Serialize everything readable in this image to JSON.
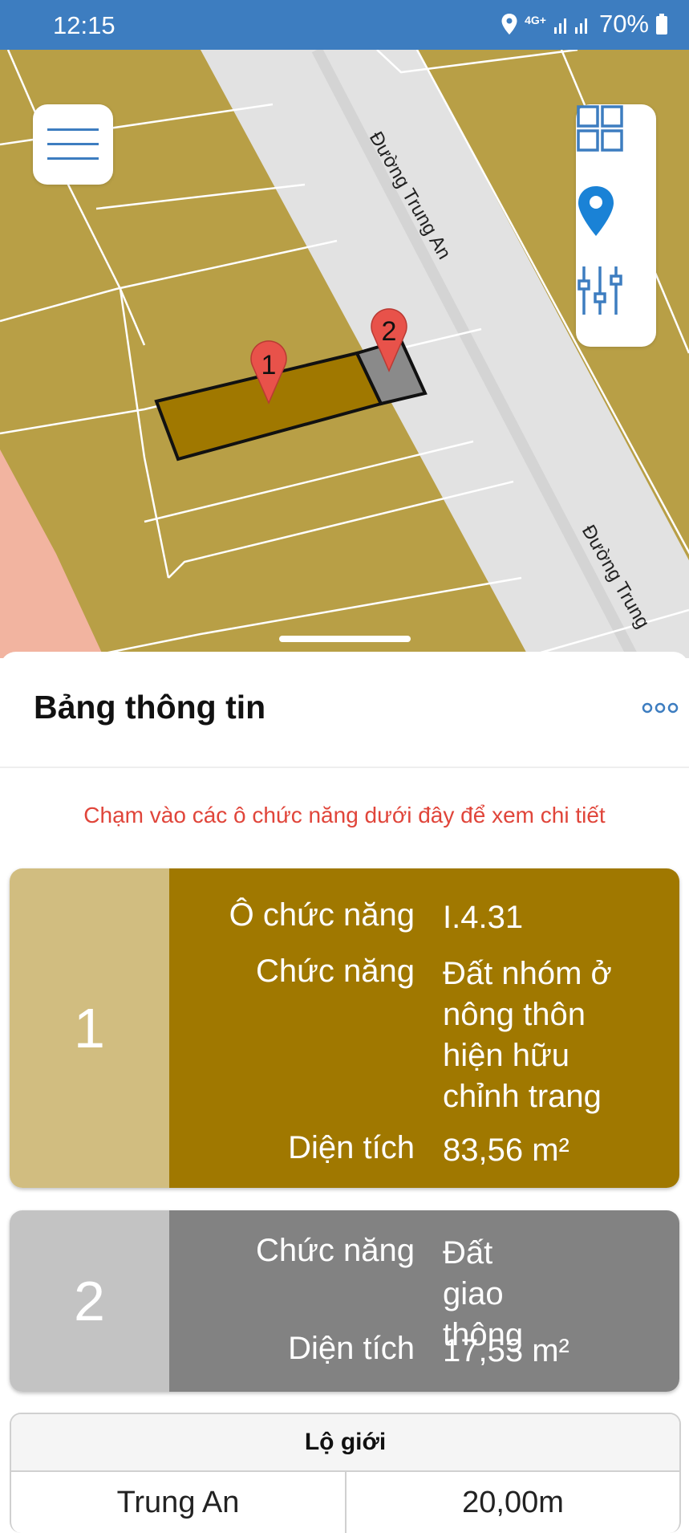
{
  "status_bar": {
    "time": "12:15",
    "network": "4G+",
    "battery": "70%"
  },
  "map": {
    "road_label_1": "Đường Trung An",
    "road_label_2": "Đường Trung",
    "markers": [
      "1",
      "2"
    ],
    "colors": {
      "land": "#b89f46",
      "road": "#e2e2e2",
      "highlight_parcel": "#a07800",
      "road_parcel": "#8a8a8a",
      "pink_zone": "#f2b4a0"
    }
  },
  "controls": {
    "menu_icon": "hamburger-menu-icon",
    "grid_icon": "grid-icon",
    "location_icon": "location-pin-icon",
    "filter_icon": "sliders-icon"
  },
  "sheet": {
    "title": "Bảng thông tin",
    "more_icon": "more-dots-icon",
    "hint": "Chạm vào các ô chức năng dưới đây để xem chi tiết"
  },
  "parcels": [
    {
      "number": "1",
      "rows": [
        {
          "label": "Ô chức năng",
          "value": "I.4.31"
        },
        {
          "label": "Chức năng",
          "value": "Đất nhóm ở nông thôn hiện hữu chỉnh trang"
        },
        {
          "label": "Diện tích",
          "value": "83,56 m²"
        }
      ],
      "color": "#a07800",
      "color_light": "#d1bd80"
    },
    {
      "number": "2",
      "rows": [
        {
          "label": "Chức năng",
          "value": "Đất giao thông"
        },
        {
          "label": "Diện tích",
          "value": "17,53 m²"
        }
      ],
      "color": "#828282",
      "color_light": "#c3c3c3"
    }
  ],
  "road_width_table": {
    "header": "Lộ giới",
    "rows": [
      {
        "road": "Trung An",
        "width": "20,00m"
      }
    ]
  }
}
